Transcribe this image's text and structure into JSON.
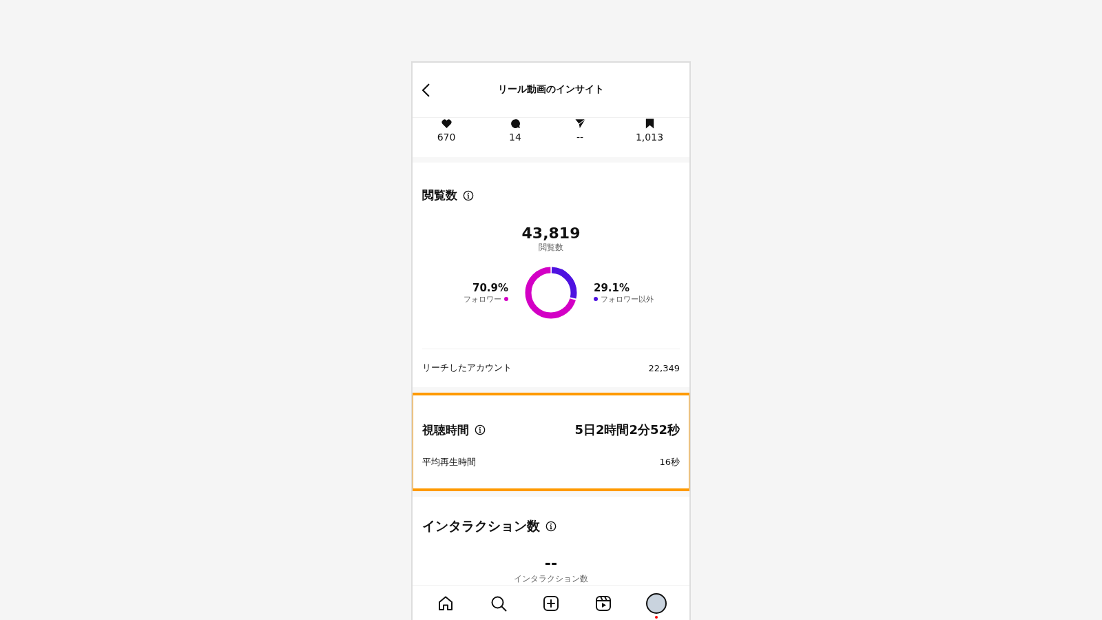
{
  "header": {
    "title": "リール動画のインサイト"
  },
  "stats": [
    {
      "kind": "likes",
      "value": "670"
    },
    {
      "kind": "comments",
      "value": "14"
    },
    {
      "kind": "shares",
      "value": "--"
    },
    {
      "kind": "saves",
      "value": "1,013"
    }
  ],
  "views": {
    "title": "閲覧数",
    "total": "43,819",
    "total_label": "閲覧数",
    "chart_data": {
      "type": "donut",
      "categories": [
        "フォロワー",
        "フォロワー以外"
      ],
      "series": [
        {
          "values": [
            70.9,
            29.1
          ]
        }
      ],
      "colors": [
        "#d300c5",
        "#4e12e0"
      ],
      "value_labels": [
        "70.9%",
        "29.1%"
      ]
    },
    "rows": [
      {
        "label": "リーチしたアカウント",
        "value": "22,349"
      }
    ]
  },
  "watch_time": {
    "title": "視聴時間",
    "value": "5日2時間2分52秒",
    "highlighted": true,
    "rows": [
      {
        "label": "平均再生時間",
        "value": "16秒"
      }
    ]
  },
  "interactions": {
    "title": "インタラクション数",
    "total": "--",
    "total_label": "インタラクション数"
  },
  "nav": [
    {
      "kind": "home"
    },
    {
      "kind": "search"
    },
    {
      "kind": "create"
    },
    {
      "kind": "reels"
    },
    {
      "kind": "profile",
      "notification": true
    }
  ]
}
